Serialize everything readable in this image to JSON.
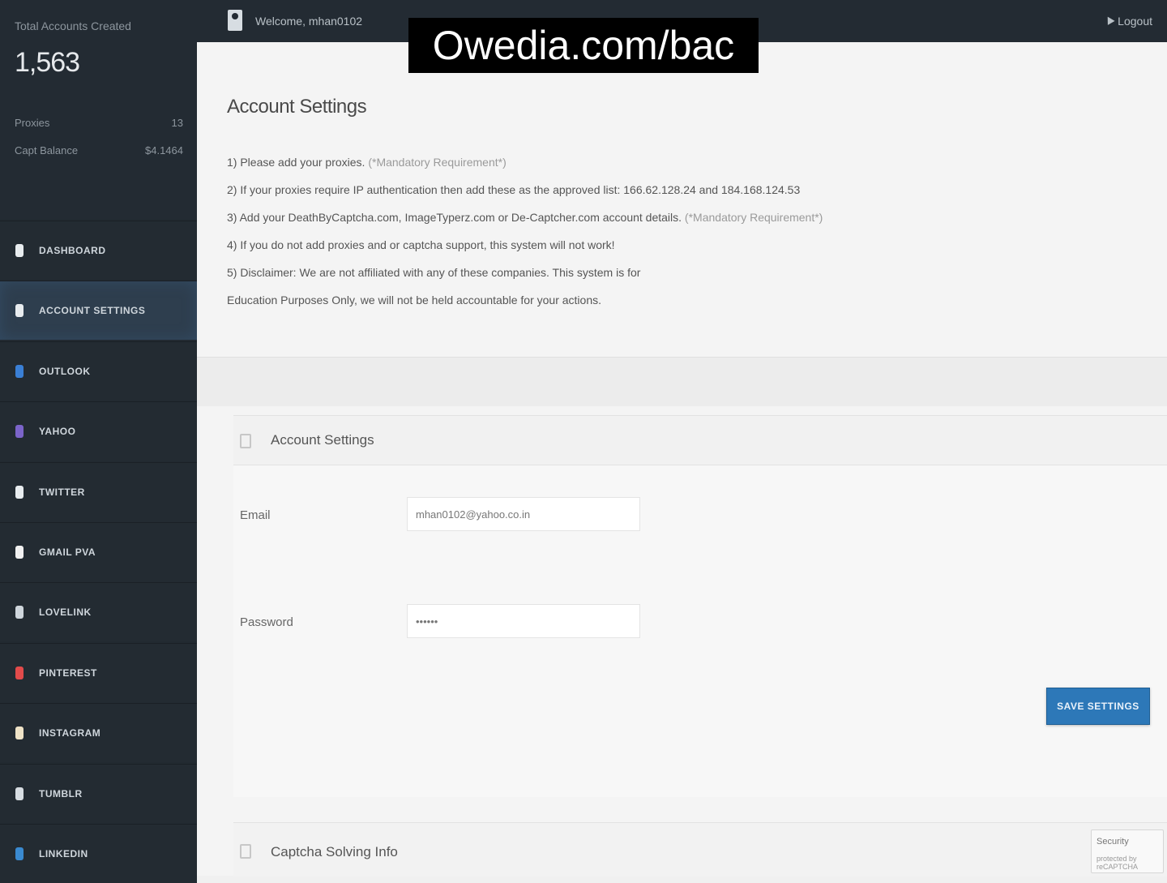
{
  "sidebar": {
    "stats": {
      "total_label": "Total Accounts Created",
      "total_value": "1,563",
      "rows": [
        {
          "label": "Proxies",
          "value": "13"
        },
        {
          "label": "Capt Balance",
          "value": "$4.1464"
        }
      ]
    },
    "nav": [
      {
        "label": "DASHBOARD",
        "icon": "home-icon",
        "color": "#e8ecef",
        "active": false
      },
      {
        "label": "ACCOUNT SETTINGS",
        "icon": "gear-icon",
        "color": "#e8ecef",
        "active": true
      },
      {
        "label": "OUTLOOK",
        "icon": "outlook-icon",
        "color": "#3a7fd5",
        "active": false
      },
      {
        "label": "YAHOO",
        "icon": "yahoo-icon",
        "color": "#7b64c9",
        "active": false
      },
      {
        "label": "TWITTER",
        "icon": "twitter-icon",
        "color": "#e8ecef",
        "active": false
      },
      {
        "label": "GMAIL PVA",
        "icon": "gmail-icon",
        "color": "#f1f1f1",
        "active": false
      },
      {
        "label": "LOVELINK",
        "icon": "lovelink-icon",
        "color": "#cfd6dc",
        "active": false
      },
      {
        "label": "PINTEREST",
        "icon": "pinterest-icon",
        "color": "#e24b4b",
        "active": false
      },
      {
        "label": "INSTAGRAM",
        "icon": "instagram-icon",
        "color": "#efe3c7",
        "active": false
      },
      {
        "label": "TUMBLR",
        "icon": "tumblr-icon",
        "color": "#d7dde2",
        "active": false
      },
      {
        "label": "LINKEDIN",
        "icon": "linkedin-icon",
        "color": "#3a8ad0",
        "active": false
      }
    ]
  },
  "topbar": {
    "welcome": "Welcome, mhan0102",
    "logout_label": "Logout"
  },
  "watermark": "Owedia.com/bac",
  "main": {
    "title": "Account Settings",
    "instructions": [
      {
        "text": "1) Please add your proxies.",
        "note": " (*Mandatory Requirement*)"
      },
      {
        "text": "2) If your proxies require IP authentication then add these as the approved list: 166.62.128.24 and 184.168.124.53",
        "note": ""
      },
      {
        "text": "3) Add your DeathByCaptcha.com, ImageTyperz.com or De-Captcher.com account details.",
        "note": " (*Mandatory Requirement*)"
      },
      {
        "text": "4) If you do not add proxies and or captcha support, this system will not work!",
        "note": ""
      },
      {
        "text": "5) Disclaimer: We are not affiliated with any of these companies. This system is for",
        "note": ""
      },
      {
        "text": "Education Purposes Only, we will not be held accountable for your actions.",
        "note": ""
      }
    ],
    "panel": {
      "title": "Account Settings",
      "email_label": "Email",
      "email_value": "mhan0102@yahoo.co.in",
      "password_label": "Password",
      "password_value": "••••••",
      "save_label": "SAVE SETTINGS"
    },
    "panel2": {
      "title": "Captcha Solving Info"
    },
    "recaptcha": {
      "title": "Security",
      "sub": "protected by reCAPTCHA"
    }
  },
  "colors": {
    "sidebar_bg": "#222a31",
    "active_bg": "#2e3e4e",
    "button_blue": "#2d78b8"
  }
}
